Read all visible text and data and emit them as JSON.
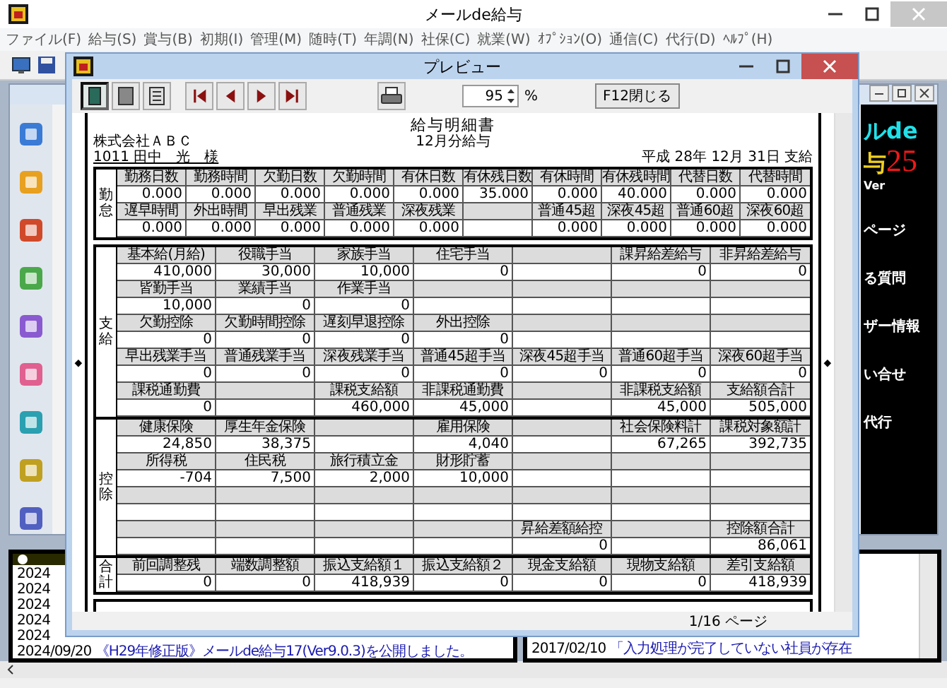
{
  "window": {
    "title": "メールde給与"
  },
  "menu": [
    "ファイル(F)",
    "給与(S)",
    "賞与(B)",
    "初期(I)",
    "管理(M)",
    "随時(T)",
    "年調(N)",
    "社保(C)",
    "就業(W)",
    "ｵﾌﾟｼｮﾝ(O)",
    "通信(C)",
    "代行(D)",
    "ﾍﾙﾌﾟ(H)"
  ],
  "side_panel": {
    "logo_line_1": "ルde",
    "logo_mark": "与",
    "logo_number": "25",
    "version": "Ver",
    "links": [
      "ページ",
      "る質問",
      "ザー情報",
      "い合せ",
      "代行"
    ]
  },
  "news_left": [
    {
      "date": "2024"
    },
    {
      "date": "2024"
    },
    {
      "date": "2024"
    },
    {
      "date": "2024"
    },
    {
      "date": "2024"
    },
    {
      "date": "2024/09/20",
      "text": "《H29年修正版》メールde給与17(Ver9.0.3)を公開しました。"
    }
  ],
  "news_right": [
    {
      "date": "2017/02/10",
      "text": "「入力処理が完了していない社員が存在"
    }
  ],
  "preview": {
    "title": "プレビュー",
    "view_buttons": [
      {
        "kind": "single",
        "selected": true
      },
      {
        "kind": "double",
        "selected": false
      },
      {
        "kind": "list",
        "selected": false
      }
    ],
    "nav_buttons": [
      {
        "kind": "first"
      },
      {
        "kind": "prev"
      },
      {
        "kind": "next"
      },
      {
        "kind": "last"
      }
    ],
    "zoom": {
      "value": "95",
      "unit": "%"
    },
    "close_button": "F12閉じる",
    "side_marks": [
      "◆",
      "◆"
    ],
    "status": "1/16 ページ"
  },
  "payslip": {
    "title": "給与明細書",
    "company": "株式会社ＡＢＣ",
    "period": "12月分給与",
    "employee": "1011 田中　光　様",
    "pay_date": "平成 28年 12月 31日 支給",
    "sections": [
      {
        "label": "勤怠",
        "rows": [
          {
            "kind": "header",
            "cells": [
              "勤務日数",
              "勤務時間",
              "欠勤日数",
              "欠勤時間",
              "有休日数",
              "有休残日数",
              "有休時間",
              "有休残時間",
              "代替日数",
              "代替時間"
            ]
          },
          {
            "kind": "value",
            "cells": [
              "0.000",
              "0.000",
              "0.000",
              "0.000",
              "0.000",
              "35.000",
              "0.000",
              "40.000",
              "0.000",
              "0.000"
            ]
          },
          {
            "kind": "header",
            "cells": [
              "遅早時間",
              "外出時間",
              "早出残業",
              "普通残業",
              "深夜残業",
              null,
              "普通45超",
              "深夜45超",
              "普通60超",
              "深夜60超"
            ]
          },
          {
            "kind": "value",
            "cells": [
              "0.000",
              "0.000",
              "0.000",
              "0.000",
              "0.000",
              null,
              "0.000",
              "0.000",
              "0.000",
              "0.000"
            ]
          }
        ]
      },
      {
        "label": "支給",
        "rows": [
          {
            "kind": "header",
            "cells": [
              "基本給(月給)",
              "役職手当",
              "家族手当",
              "住宅手当",
              null,
              "課昇給差給与",
              "非昇給差給与"
            ]
          },
          {
            "kind": "value",
            "cells": [
              "410,000",
              "30,000",
              "10,000",
              "0",
              null,
              "0",
              "0"
            ]
          },
          {
            "kind": "header",
            "cells": [
              "皆勤手当",
              "業績手当",
              "作業手当",
              null,
              null,
              null,
              null
            ]
          },
          {
            "kind": "value",
            "cells": [
              "10,000",
              "0",
              "0",
              null,
              null,
              null,
              null
            ]
          },
          {
            "kind": "header",
            "cells": [
              "欠勤控除",
              "欠勤時間控除",
              "遅刻早退控除",
              "外出控除",
              null,
              null,
              null
            ]
          },
          {
            "kind": "value",
            "cells": [
              "0",
              "0",
              "0",
              "0",
              null,
              null,
              null
            ]
          },
          {
            "kind": "header",
            "cells": [
              "早出残業手当",
              "普通残業手当",
              "深夜残業手当",
              "普通45超手当",
              "深夜45超手当",
              "普通60超手当",
              "深夜60超手当"
            ]
          },
          {
            "kind": "value",
            "cells": [
              "0",
              "0",
              "0",
              "0",
              "0",
              "0",
              "0"
            ]
          },
          {
            "kind": "header",
            "cells": [
              "課税通勤費",
              null,
              "課税支給額",
              "非課税通勤費",
              null,
              "非課税支給額",
              "支給額合計"
            ]
          },
          {
            "kind": "value",
            "cells": [
              "0",
              null,
              "460,000",
              "45,000",
              null,
              "45,000",
              "505,000"
            ]
          }
        ]
      },
      {
        "label": "控除",
        "rows": [
          {
            "kind": "header",
            "cells": [
              "健康保険",
              "厚生年金保険",
              null,
              "雇用保険",
              null,
              "社会保険料計",
              "課税対象額計"
            ]
          },
          {
            "kind": "value",
            "cells": [
              "24,850",
              "38,375",
              null,
              "4,040",
              null,
              "67,265",
              "392,735"
            ]
          },
          {
            "kind": "header",
            "cells": [
              "所得税",
              "住民税",
              "旅行積立金",
              "財形貯蓄",
              null,
              null,
              null
            ]
          },
          {
            "kind": "value",
            "cells": [
              "-704",
              "7,500",
              "2,000",
              "10,000",
              null,
              null,
              null
            ]
          },
          {
            "kind": "header",
            "cells": [
              null,
              null,
              null,
              null,
              null,
              null,
              null
            ]
          },
          {
            "kind": "value",
            "cells": [
              null,
              null,
              null,
              null,
              null,
              null,
              null
            ]
          },
          {
            "kind": "header",
            "cells": [
              null,
              null,
              null,
              null,
              "昇給差額給控",
              null,
              "控除額合計"
            ]
          },
          {
            "kind": "value",
            "cells": [
              null,
              null,
              null,
              null,
              "0",
              null,
              "86,061"
            ]
          }
        ]
      },
      {
        "label": "合計",
        "rows": [
          {
            "kind": "header",
            "cells": [
              "前回調整残",
              "端数調整額",
              "振込支給額１",
              "振込支給額２",
              "現金支給額",
              "現物支給額",
              "差引支給額"
            ]
          },
          {
            "kind": "value",
            "cells": [
              "0",
              "0",
              "418,939",
              "0",
              "0",
              "0",
              "418,939"
            ]
          }
        ]
      }
    ]
  }
}
